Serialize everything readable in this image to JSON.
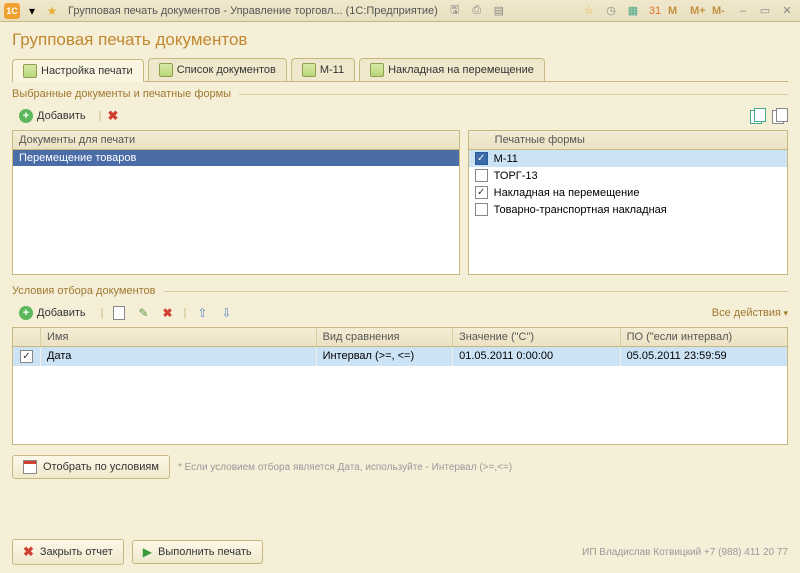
{
  "titlebar": {
    "app_badge": "1C",
    "title": "Групповая печать документов - Управление торговл...    (1С:Предприятие)",
    "mem_buttons": [
      "M",
      "M+",
      "M-"
    ]
  },
  "page_title": "Групповая печать документов",
  "tabs": [
    {
      "label": "Настройка печати",
      "active": true
    },
    {
      "label": "Список документов",
      "active": false
    },
    {
      "label": "М-11",
      "active": false
    },
    {
      "label": "Накладная на перемещение",
      "active": false
    }
  ],
  "section1_label": "Выбранные документы и печатные формы",
  "toolbar1": {
    "add_label": "Добавить"
  },
  "docs_panel": {
    "header": "Документы для печати",
    "rows": [
      {
        "label": "Перемещение товаров",
        "selected": true
      }
    ]
  },
  "forms_panel": {
    "header": "Печатные формы",
    "rows": [
      {
        "checked": true,
        "label": "М-11",
        "highlight": true
      },
      {
        "checked": false,
        "label": "ТОРГ-13"
      },
      {
        "checked": true,
        "label": "Накладная на перемещение"
      },
      {
        "checked": false,
        "label": "Товарно-транспортная накладная"
      }
    ]
  },
  "section2_label": "Условия отбора документов",
  "toolbar2": {
    "add_label": "Добавить",
    "all_actions": "Все действия"
  },
  "grid": {
    "headers": {
      "name": "Имя",
      "cmp": "Вид сравнения",
      "val": "Значение (\"С\")",
      "to": "ПО (\"если интервал)"
    },
    "rows": [
      {
        "checked": true,
        "name": "Дата",
        "cmp": "Интервал (>=, <=)",
        "val": "01.05.2011 0:00:00",
        "to": "05.05.2011 23:59:59"
      }
    ]
  },
  "filter_btn_label": "Отобрать по условиям",
  "filter_note": "* Если условием отбора является Дата, используйте - Интервал (>=,<=)",
  "footer": {
    "close_label": "Закрыть отчет",
    "print_label": "Выполнить печать",
    "vendor": "ИП Владислав Котвицкий +7 (988) 411 20 77"
  }
}
